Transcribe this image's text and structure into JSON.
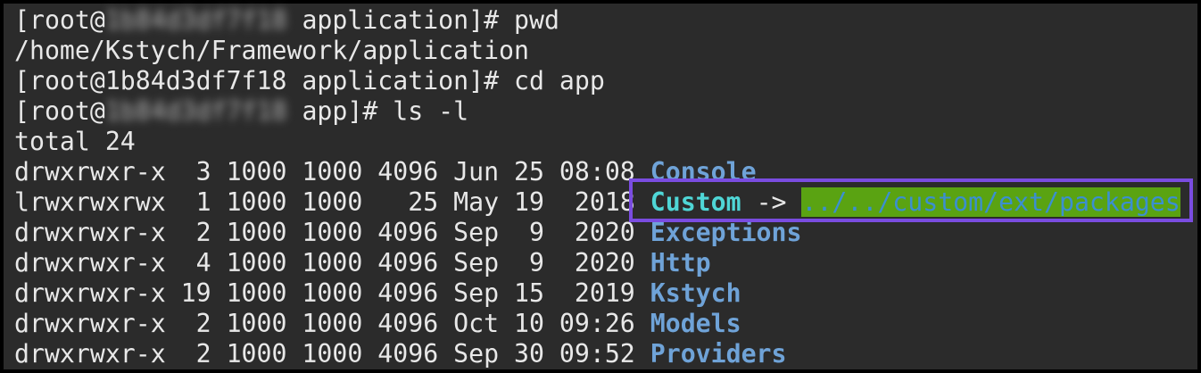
{
  "terminal": {
    "lines": {
      "l1": {
        "prefix": "[root@",
        "host": "1b84d3df7f18",
        "suffix": " application]# pwd"
      },
      "l2": {
        "text": "/home/Kstych/Framework/application"
      },
      "l3": {
        "text": "[root@1b84d3df7f18 application]# cd app"
      },
      "l4": {
        "prefix": "[root@",
        "host": "1b84d3df7f18",
        "suffix": " app]# ls -l"
      },
      "l5": {
        "text": "total 24"
      }
    },
    "listing": [
      {
        "meta": "drwxrwxr-x  3 1000 1000 4096 Jun 25 08:08 ",
        "name": "Console"
      },
      {
        "meta": "lrwxrwxrwx  1 1000 1000   25 May 19  2018 ",
        "name": "Custom",
        "arrow": " -> ",
        "target": "../../custom/ext/packages"
      },
      {
        "meta": "drwxrwxr-x  2 1000 1000 4096 Sep  9  2020 ",
        "name": "Exceptions"
      },
      {
        "meta": "drwxrwxr-x  4 1000 1000 4096 Sep  9  2020 ",
        "name": "Http"
      },
      {
        "meta": "drwxrwxr-x 19 1000 1000 4096 Sep 15  2019 ",
        "name": "Kstych"
      },
      {
        "meta": "drwxrwxr-x  2 1000 1000 4096 Oct 10 09:26 ",
        "name": "Models"
      },
      {
        "meta": "drwxrwxr-x  2 1000 1000 4096 Sep 30 09:52 ",
        "name": "Providers"
      }
    ]
  },
  "colors": {
    "background": "#2b2b2b",
    "text": "#e8e8e8",
    "directory": "#6fa3d8",
    "symlink": "#4fd6d6",
    "symlink_target_bg": "#5aa312",
    "highlight_border": "#7a4ce0"
  }
}
